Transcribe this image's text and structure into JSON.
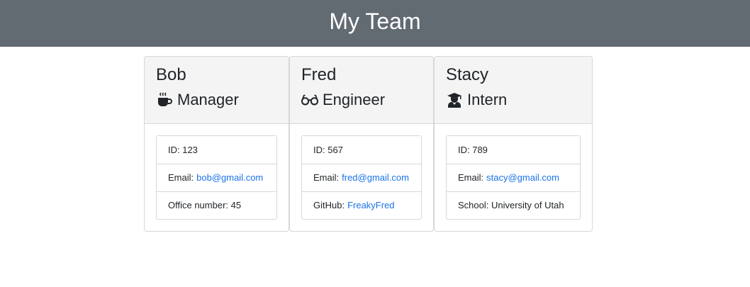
{
  "header": {
    "title": "My Team"
  },
  "employees": [
    {
      "name": "Bob",
      "role": "Manager",
      "icon": "coffee-icon",
      "id_label": "ID: 123",
      "email_prefix": "Email:",
      "email": "bob@gmail.com",
      "extra_label": "Office number: 45"
    },
    {
      "name": "Fred",
      "role": "Engineer",
      "icon": "glasses-icon",
      "id_label": "ID: 567",
      "email_prefix": "Email:",
      "email": "fred@gmail.com",
      "extra_prefix": "GitHub:",
      "extra_link": "FreakyFred"
    },
    {
      "name": "Stacy",
      "role": "Intern",
      "icon": "graduate-icon",
      "id_label": "ID: 789",
      "email_prefix": "Email:",
      "email": "stacy@gmail.com",
      "extra_label": "School: University of Utah"
    }
  ],
  "colors": {
    "header_bg": "#626a72",
    "link": "#1a73e8",
    "card_head_bg": "#f4f4f4"
  }
}
